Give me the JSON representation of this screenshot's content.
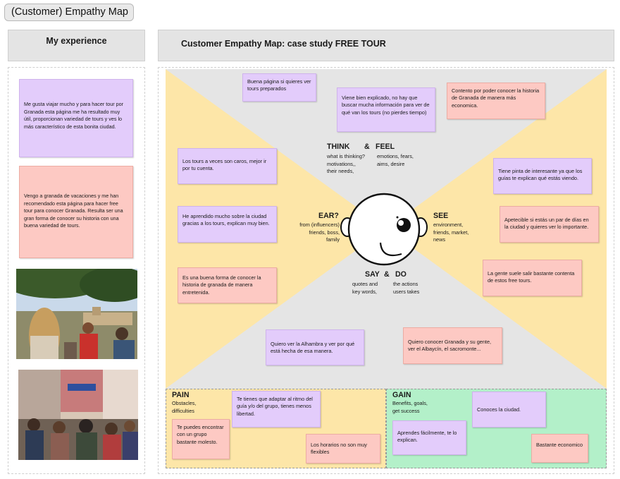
{
  "page_title": "(Customer) Empathy Map",
  "left_column": {
    "header": "My experience",
    "notes": [
      "Me gusta viajar mucho y para hacer tour por Granada esta página me ha resultado muy útil, proporcionan variedad de tours y ves lo más característico de esta bonita ciudad.",
      "Vengo a granada de vacaciones y me han recomendado esta página para hacer free tour para conocer Granada. Resulta ser una gran forma de conocer su historia con una buena variedad de  tours."
    ]
  },
  "map": {
    "header": "Customer Empathy Map: case study  FREE TOUR",
    "think": {
      "title": "THINK",
      "amp": "&",
      "title2": "FEEL",
      "sub1": "what is  thinking?\nmotivations,,\ntheir needs,",
      "sub2": "emotions, fears,\naims, desire"
    },
    "hear": {
      "title": "EAR?",
      "sub": "from (influencers)\nfriends, boss,\nfamily"
    },
    "see": {
      "title": "SEE",
      "sub": "environment,\nfriends, market,\nnews"
    },
    "say": {
      "title": "SAY",
      "amp": "&",
      "title2": "DO",
      "sub1": "quotes and\nkey words,",
      "sub2": "the actions\nusers takes"
    },
    "notes": {
      "n1": "Buena página si quieres ver tours preparados",
      "n2": "Viene bien explicado, no hay que buscar mucha información para ver de qué van los tours (no pierdes tiempo)",
      "n3": "Contento por poder conocer la historia de Granada de  manera más economica.",
      "n4": "Los tours a veces son caros, mejor ir por tu cuenta.",
      "n5": "Tiene pinta de interesante ya que los guías te explican qué estás viendo.",
      "n6": "He aprendido mucho sobre la ciudad gracias a los tours, explican muy bien.",
      "n7": "Apetecible si estás un par de días en la ciudad y quieres ver lo importante.",
      "n8": "Es una buena forma de conocer la historia de granada de manera entretenida.",
      "n9": "La gente suele salir bastante contenta de estos free tours.",
      "n10": "Quiero ver la Alhambra y ver por qué está hecha de esa manera.",
      "n11": "Quiero conocer Granada y su gente, ver el Albaycín, el sacromonte..."
    },
    "pain": {
      "title": "PAIN",
      "sub": "Obstacles,\ndifficulties",
      "notes": [
        "Te tienes que adaptar al ritmo del guía y/o del  grupo, tienes menos libertad.",
        "Te puedes encontrar con un grupo bastante molesto.",
        "Los horarios no son muy flexibles"
      ]
    },
    "gain": {
      "title": "GAIN",
      "sub": "Benefits, goals,\nget success",
      "notes": [
        "Conoces la ciudad.",
        "Aprendes fácilmente, te lo explican.",
        "Bastante economico"
      ]
    }
  },
  "colors": {
    "purple_note": "#e3ccfb",
    "pink_note": "#fdc9c3",
    "think_say_quadrant": "#e5e5e5",
    "hear_see_quadrant": "#fde6a8",
    "pain_background": "#fde6a8",
    "gain_background": "#b3f0c9"
  },
  "icons": [
    "head-face-icon"
  ]
}
